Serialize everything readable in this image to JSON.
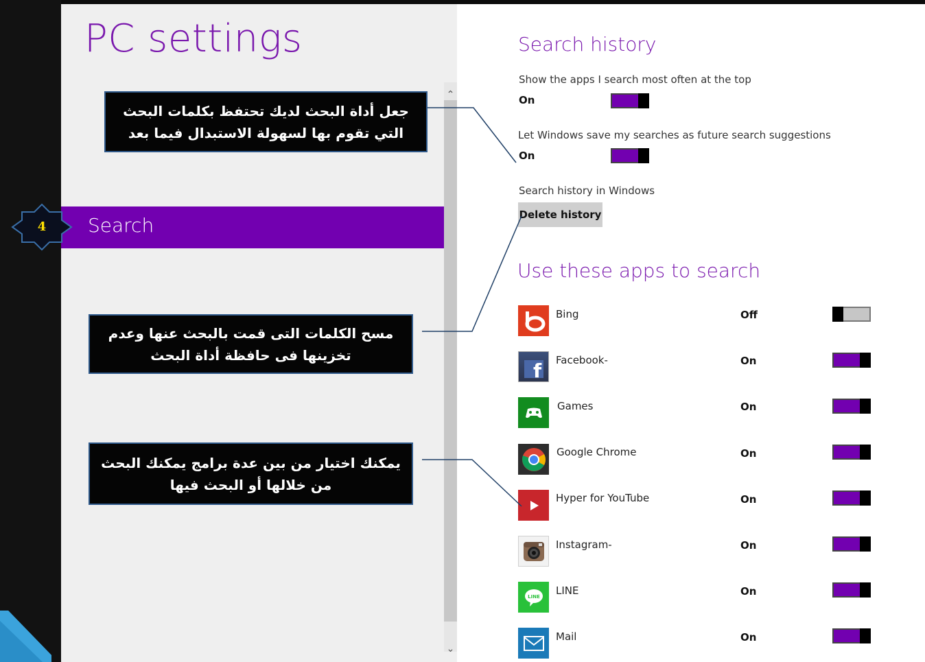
{
  "header": {
    "title": "PC settings"
  },
  "nav": {
    "selected_label": "Search",
    "step_badge": "4"
  },
  "callouts": [
    {
      "line1": "جعل أداة البحث لديك تحتفظ بكلمات البحث",
      "line2": "التي تقوم بها لسهولة الاستبدال فيما بعد"
    },
    {
      "line1": "مسح الكلمات التى قمت بالبحث عنها وعدم",
      "line2": "تخزينها فى حافظة أداة البحث"
    },
    {
      "line1": "يمكنك اختيار من بين عدة برامج يمكنك البحث",
      "line2": "من خلالها أو البحث فيها"
    }
  ],
  "search_history": {
    "title": "Search history",
    "settings": [
      {
        "label": "Show the apps I search most often at the top",
        "state": "On",
        "on": true
      },
      {
        "label": "Let Windows save my searches as future search suggestions",
        "state": "On",
        "on": true
      }
    ],
    "history_label": "Search history in Windows",
    "delete_button": "Delete history"
  },
  "apps_section": {
    "title": "Use these apps to search",
    "apps": [
      {
        "name": "Bing",
        "state": "Off",
        "on": false,
        "icon": "bing-icon",
        "color": "#e03c1e"
      },
      {
        "name": "Facebook-",
        "state": "On",
        "on": true,
        "icon": "facebook-icon",
        "color": "#3b5998"
      },
      {
        "name": "Games",
        "state": "On",
        "on": true,
        "icon": "games-controller-icon",
        "color": "#128c1f"
      },
      {
        "name": "Google Chrome",
        "state": "On",
        "on": true,
        "icon": "chrome-icon",
        "color": "#2d2d2d"
      },
      {
        "name": "Hyper for YouTube",
        "state": "On",
        "on": true,
        "icon": "youtube-play-icon",
        "color": "#c8262c"
      },
      {
        "name": "Instagram-",
        "state": "On",
        "on": true,
        "icon": "instagram-camera-icon",
        "color": "#f2f2f2"
      },
      {
        "name": "LINE",
        "state": "On",
        "on": true,
        "icon": "line-chat-icon",
        "color": "#29c13a"
      },
      {
        "name": "Mail",
        "state": "On",
        "on": true,
        "icon": "mail-envelope-icon",
        "color": "#1a7ab8"
      }
    ]
  },
  "colors": {
    "accent": "#7200b0",
    "title_purple": "#7a18ad",
    "callout_border": "#2f5a8c",
    "badge_number": "#ffe100"
  }
}
